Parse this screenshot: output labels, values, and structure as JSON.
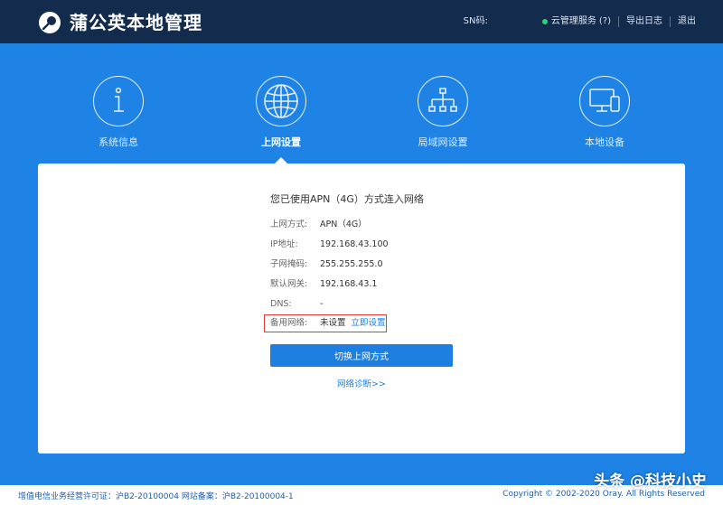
{
  "header": {
    "brand": "蒲公英本地管理",
    "sn_label": "SN码:",
    "cloud_service": "云管理服务",
    "help": "(?)",
    "export_log": "导出日志",
    "logout": "退出"
  },
  "nav": {
    "items": [
      {
        "label": "系统信息",
        "icon": "info-icon"
      },
      {
        "label": "上网设置",
        "icon": "globe-icon"
      },
      {
        "label": "局域网设置",
        "icon": "network-tree-icon"
      },
      {
        "label": "本地设备",
        "icon": "devices-icon"
      }
    ],
    "active": "上网设置"
  },
  "panel": {
    "title": "您已使用APN（4G）方式连入网络",
    "rows": [
      {
        "key": "上网方式:",
        "value": "APN（4G）"
      },
      {
        "key": "IP地址:",
        "value": "192.168.43.100"
      },
      {
        "key": "子网掩码:",
        "value": "255.255.255.0"
      },
      {
        "key": "默认网关:",
        "value": "192.168.43.1"
      },
      {
        "key": "DNS:",
        "value": "-"
      },
      {
        "key": "备用网络:",
        "value": "未设置",
        "link": "立即设置"
      }
    ],
    "switch_button": "切换上网方式",
    "diagnose_link": "网络诊断>>"
  },
  "footer": {
    "license": "增值电信业务经营许可证：沪B2-20100004 网站备案：沪B2-20100004-1",
    "copyright": "Copyright © 2002-2020 Oray. All Rights Reserved"
  },
  "watermark": "头条 @科技小史",
  "colors": {
    "header_bg": "#132b4d",
    "body_bg": "#1e83e4",
    "accent": "#1e7fe0",
    "highlight": "#e53935",
    "status_ok": "#33d07b"
  }
}
